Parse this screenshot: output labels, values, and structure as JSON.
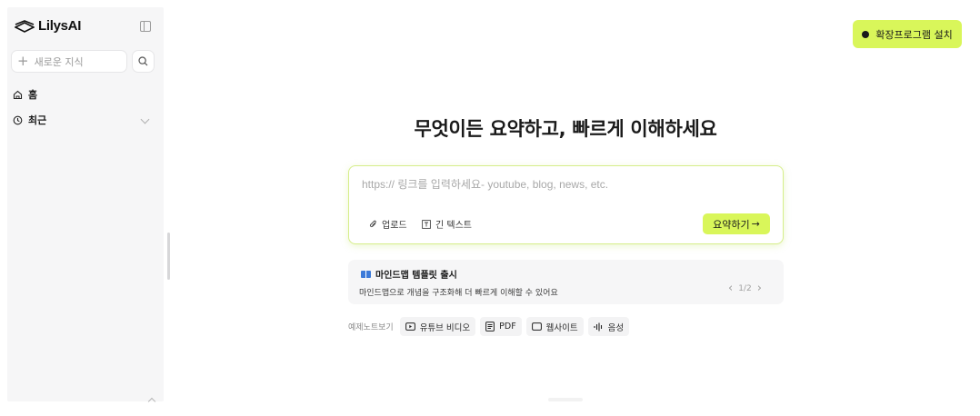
{
  "app": {
    "logo_text": "LilysAI"
  },
  "sidebar": {
    "new_knowledge_placeholder": "새로운 지식",
    "items": [
      {
        "label": "홈",
        "icon": "home-icon"
      },
      {
        "label": "최근",
        "icon": "clock-icon"
      }
    ]
  },
  "header": {
    "install_label": "확장프로그램 설치"
  },
  "main": {
    "headline": "무엇이든 요약하고, 빠르게 이해하세요",
    "input": {
      "placeholder": "https:// 링크를 입력하세요- youtube, blog, news, etc.",
      "value": ""
    },
    "tools": {
      "upload_label": "업로드",
      "long_text_label": "긴 텍스트"
    },
    "summarize_label": "요약하기",
    "summarize_arrow": "→",
    "notice": {
      "title": "마인드맵 템플릿 출시",
      "description": "마인드맵으로 개념을 구조화해 더 빠르게 이해할 수 있어요",
      "pager": "1/2"
    },
    "examples": {
      "label": "예제노트보기",
      "chips": [
        "유튜브 비디오",
        "PDF",
        "웹사이트",
        "음성"
      ]
    }
  },
  "colors": {
    "accent": "#d9f65a",
    "sidebar_bg": "#f6f6f7",
    "input_border": "#d6ee8a"
  }
}
